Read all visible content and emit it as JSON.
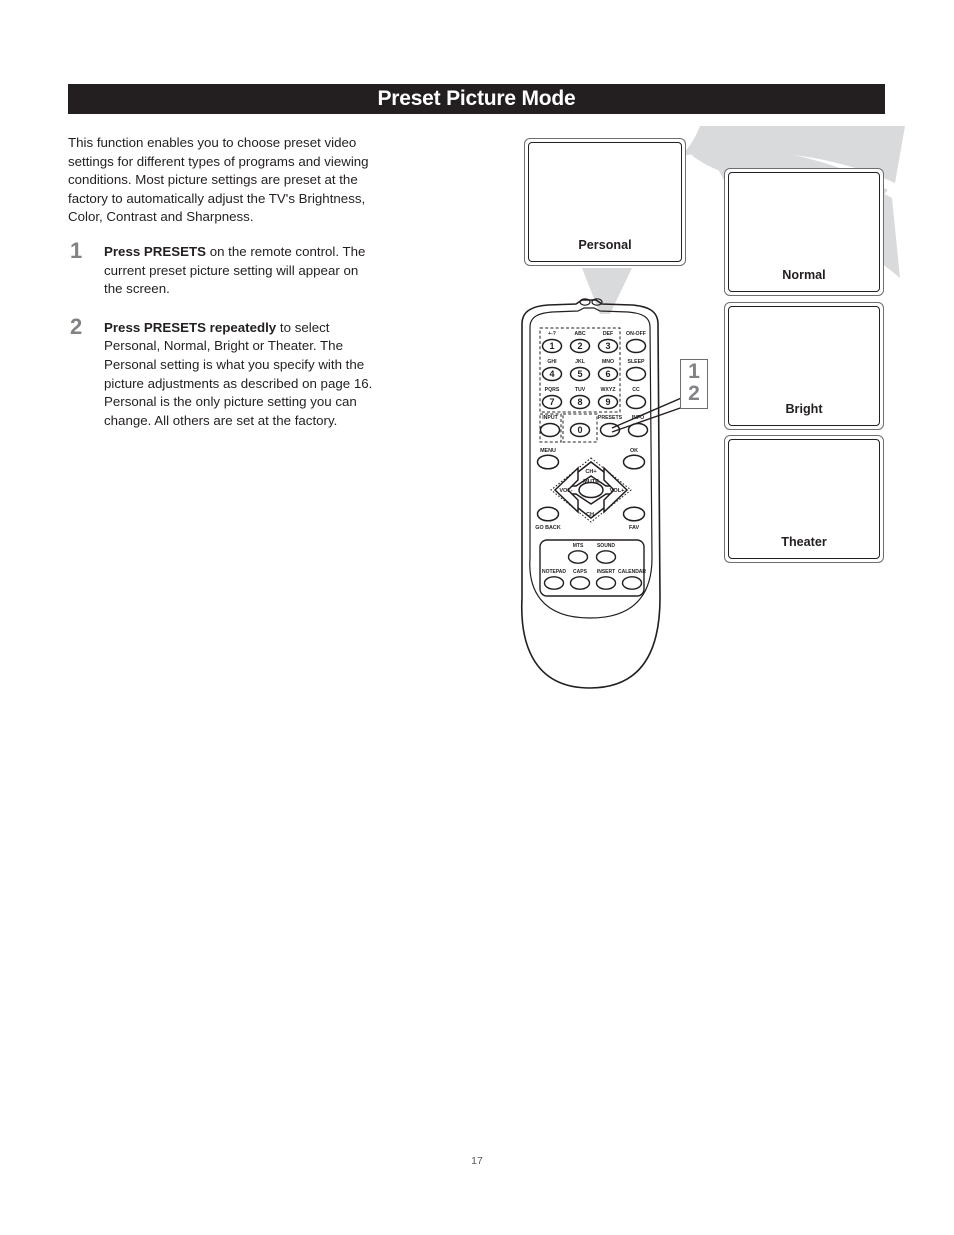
{
  "header": {
    "title": "Preset Picture Mode"
  },
  "body": {
    "intro": "This function enables you to choose preset video settings for different types of programs and viewing conditions. Most picture settings are preset at the factory to automatically adjust the TV's Brightness, Color, Contrast and Sharpness.",
    "steps": [
      {
        "number": "1",
        "bold": "Press PRESETS",
        "rest": " on the remote control. The current preset picture setting will appear on the screen."
      },
      {
        "number": "2",
        "bold": "Press PRESETS repeatedly",
        "rest": " to select Personal, Normal, Bright or Theater. The Personal setting is what you specify with the picture adjustments as described on page 16. Personal is the only picture setting you can change. All others are set at the factory."
      }
    ]
  },
  "illustration": {
    "screens": [
      {
        "id": "personal",
        "label": "Personal"
      },
      {
        "id": "normal",
        "label": "Normal"
      },
      {
        "id": "bright",
        "label": "Bright"
      },
      {
        "id": "theater",
        "label": "Theater"
      }
    ],
    "callout": {
      "first": "1",
      "second": "2"
    },
    "remote": {
      "keypad": [
        {
          "sub": "+-?",
          "digit": "1"
        },
        {
          "sub": "ABC",
          "digit": "2"
        },
        {
          "sub": "DEF",
          "digit": "3"
        },
        {
          "sub": "GHI",
          "digit": "4"
        },
        {
          "sub": "JKL",
          "digit": "5"
        },
        {
          "sub": "MNO",
          "digit": "6"
        },
        {
          "sub": "PQRS",
          "digit": "7"
        },
        {
          "sub": "TUV",
          "digit": "8"
        },
        {
          "sub": "WXYZ",
          "digit": "9"
        }
      ],
      "right_column": [
        "ON-OFF",
        "SLEEP",
        "CC"
      ],
      "row_input": [
        "INPUT",
        "0",
        "PRESETS",
        "INFO"
      ],
      "row_menu": [
        "MENU",
        "OK"
      ],
      "dpad": {
        "up": "CH+",
        "down": "CH-",
        "left": "VOL-",
        "right": "VOL+",
        "center": "MUTE"
      },
      "row_back": [
        "GO BACK",
        "FAV"
      ],
      "bottom_top_row": [
        "MTS",
        "SOUND"
      ],
      "bottom_row": [
        "NOTEPAD",
        "CAPS",
        "INSERT",
        "CALENDAR"
      ]
    }
  },
  "footer": {
    "page_number": "17"
  },
  "colors": {
    "header_bg": "#231f20",
    "header_text": "#ffffff",
    "step_number": "#808285",
    "arrow_gray": "#d9dadb",
    "outline": "#231f20"
  }
}
